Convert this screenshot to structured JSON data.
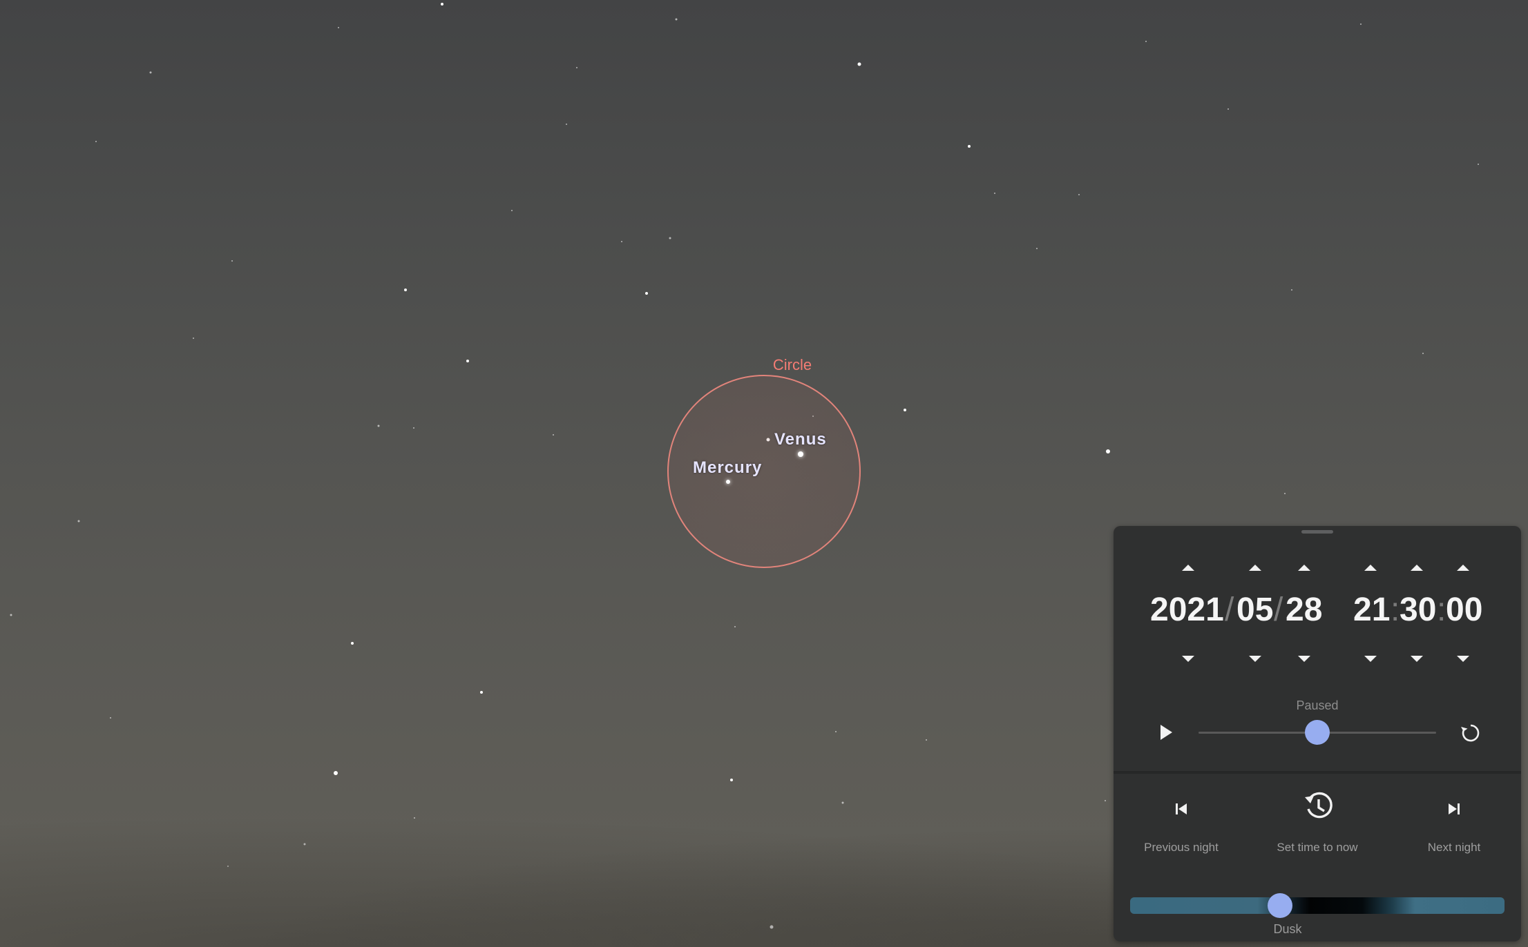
{
  "sky": {
    "circle_label": "Circle",
    "planets": [
      {
        "name": "Venus"
      },
      {
        "name": "Mercury"
      }
    ]
  },
  "time_panel": {
    "date": {
      "year": "2021",
      "month": "05",
      "day": "28",
      "separator": "/"
    },
    "time": {
      "hour": "21",
      "minute": "30",
      "second": "00",
      "separator": ":"
    },
    "status": "Paused",
    "time_speed_fraction": 0.5,
    "actions": {
      "previous_night": "Previous night",
      "set_time_to_now": "Set time to now",
      "next_night": "Next night"
    },
    "twilight": {
      "label": "Dusk",
      "position_fraction": 0.4
    },
    "colors": {
      "accent": "#97adf0",
      "panel": "#2f3030",
      "circle": "#e2847b"
    }
  }
}
